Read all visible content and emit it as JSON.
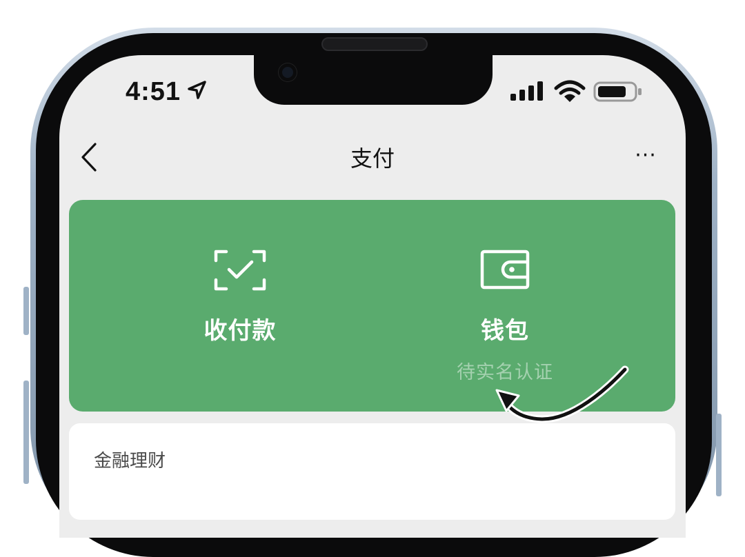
{
  "status_bar": {
    "time": "4:51"
  },
  "nav": {
    "title": "支付",
    "more": "···"
  },
  "pay_card": {
    "color": "#5aab6e",
    "receive": {
      "label": "收付款"
    },
    "wallet": {
      "label": "钱包",
      "sublabel": "待实名认证"
    }
  },
  "finance": {
    "title": "金融理财"
  }
}
